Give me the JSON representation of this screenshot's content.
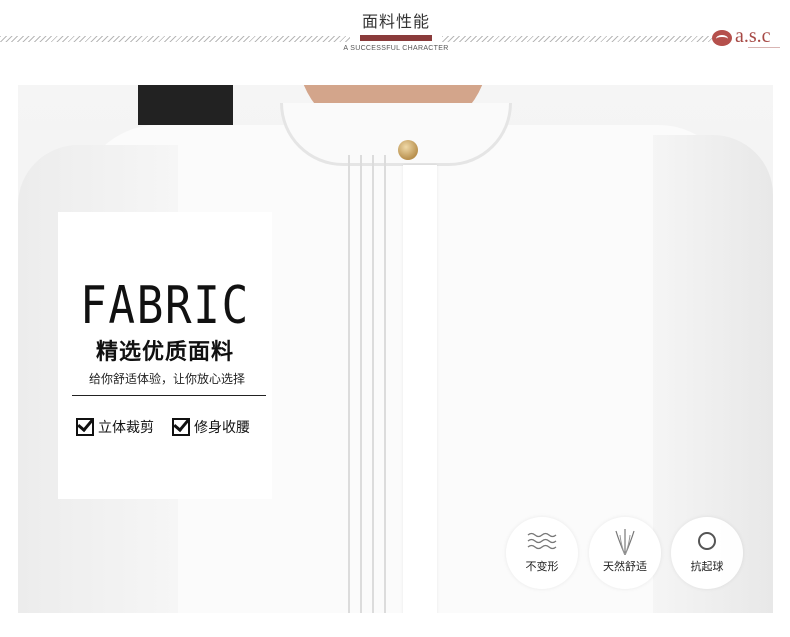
{
  "header": {
    "title": "面料性能",
    "subtitle": "A SUCCESSFUL CHARACTER",
    "logo_text": "a.s.c",
    "accent_color": "#8a3b3b"
  },
  "card": {
    "big_word": "FABRIC",
    "headline": "精选优质面料",
    "tagline": "给你舒适体验，让你放心选择",
    "features": [
      {
        "icon": "checkbox-checked-icon",
        "label": "立体裁剪"
      },
      {
        "icon": "checkbox-checked-icon",
        "label": "修身收腰"
      }
    ]
  },
  "badges": [
    {
      "icon": "waves-icon",
      "label": "不变形"
    },
    {
      "icon": "grass-icon",
      "label": "天然舒适"
    },
    {
      "icon": "circle-icon",
      "label": "抗起球"
    }
  ]
}
